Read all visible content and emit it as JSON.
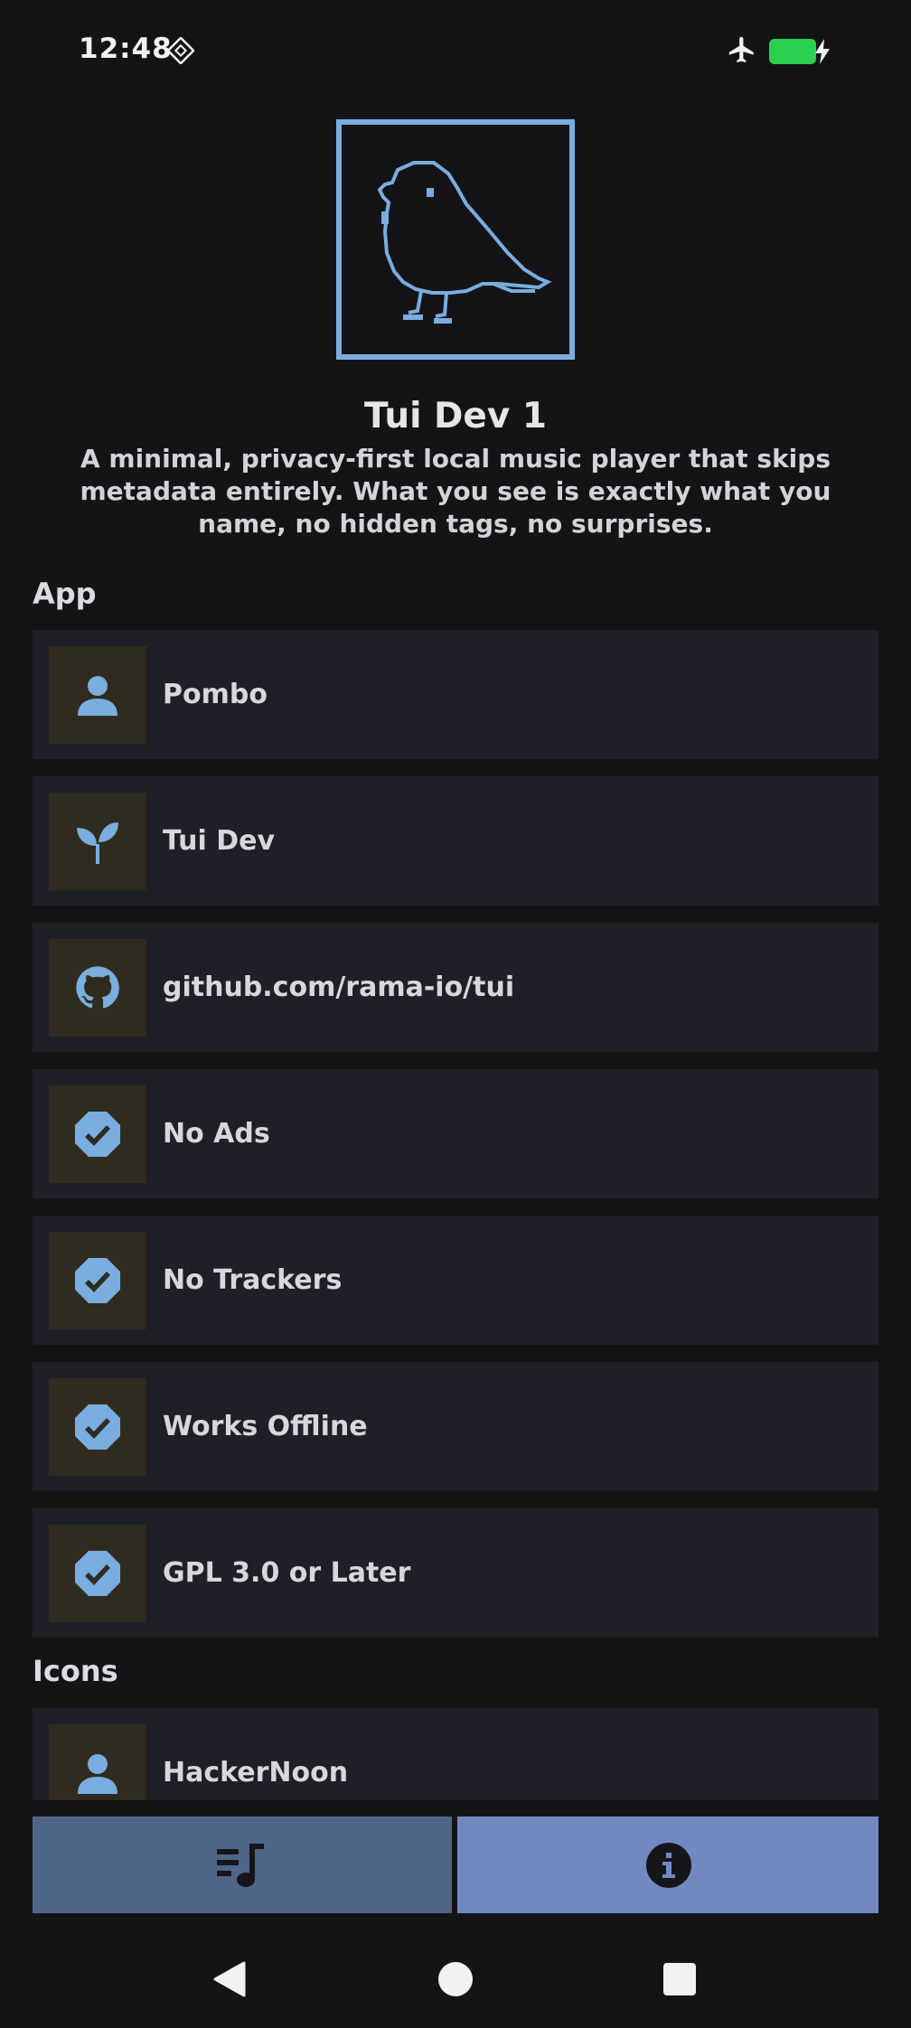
{
  "status_bar": {
    "time": "12:48"
  },
  "header": {
    "title": "Tui Dev 1",
    "description": "A minimal, privacy-first local music player that skips metadata entirely. What you see is exactly what you name, no hidden tags, no surprises."
  },
  "sections": [
    {
      "label": "App",
      "items": [
        {
          "label": "Pombo",
          "icon": "person-icon"
        },
        {
          "label": "Tui Dev",
          "icon": "sprout-icon"
        },
        {
          "label": "github.com/rama-io/tui",
          "icon": "github-icon"
        },
        {
          "label": "No Ads",
          "icon": "check-badge-icon"
        },
        {
          "label": "No Trackers",
          "icon": "check-badge-icon"
        },
        {
          "label": "Works Offline",
          "icon": "check-badge-icon"
        },
        {
          "label": "GPL 3.0 or Later",
          "icon": "check-badge-icon"
        }
      ]
    },
    {
      "label": "Icons",
      "items": [
        {
          "label": "HackerNoon",
          "icon": "person-icon"
        }
      ]
    }
  ],
  "bottom_nav": [
    {
      "name": "playlist",
      "icon": "playlist-music-icon",
      "selected": false
    },
    {
      "name": "about",
      "icon": "info-icon",
      "selected": true
    }
  ],
  "colors": {
    "background": "#141417",
    "card": "#1f1f28",
    "icon_box": "#2f2c1f",
    "accent": "#7aade0",
    "nav_inactive": "#506688",
    "nav_active": "#7189c0"
  }
}
